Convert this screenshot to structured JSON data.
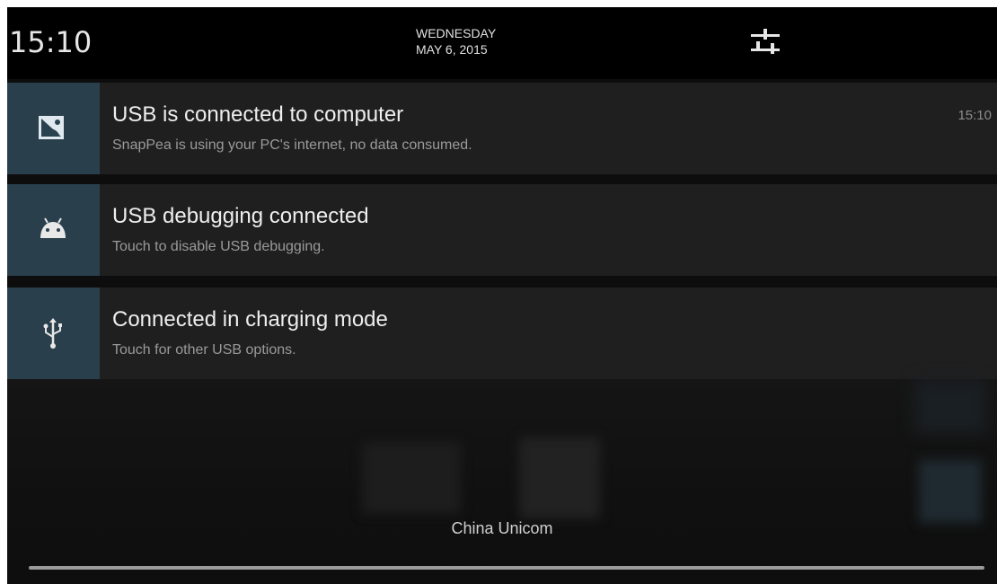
{
  "status_header": {
    "time": "15:10",
    "day": "WEDNESDAY",
    "date": "MAY 6, 2015",
    "settings_icon": "sliders-settings-icon"
  },
  "notifications": [
    {
      "icon": "snappea-app-icon",
      "title": "USB is connected to computer",
      "text": "SnapPea is using your PC's internet, no data consumed.",
      "time": "15:10"
    },
    {
      "icon": "android-debug-icon",
      "title": "USB debugging connected",
      "text": "Touch to disable USB debugging."
    },
    {
      "icon": "usb-icon",
      "title": "Connected in charging mode",
      "text": "Touch for other USB options."
    }
  ],
  "carrier": "China Unicom",
  "colors": {
    "icon_cell": "#2a3f4c",
    "card": "#1f1f1f",
    "header": "#000000"
  }
}
